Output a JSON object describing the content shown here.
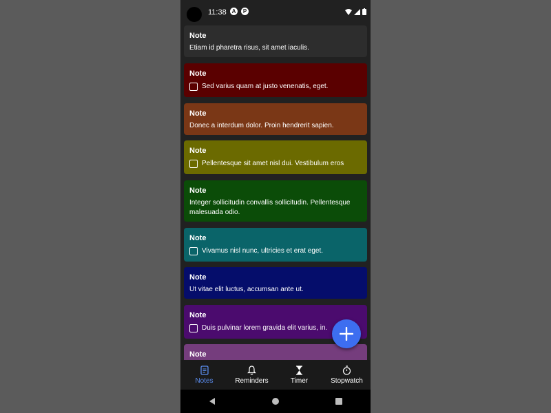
{
  "status_bar": {
    "time": "11:38"
  },
  "notes": [
    {
      "title": "Note",
      "body": "Etiam id pharetra risus, sit amet iaculis.",
      "checklist": false,
      "color": "#2d2d2d"
    },
    {
      "title": "Note",
      "body": "Sed varius quam at justo venenatis, eget.",
      "checklist": true,
      "color": "#5a0000"
    },
    {
      "title": "Note",
      "body": "Donec a interdum dolor. Proin hendrerit sapien.",
      "checklist": false,
      "color": "#7a3716"
    },
    {
      "title": "Note",
      "body": "Pellentesque sit amet nisl dui. Vestibulum eros",
      "checklist": true,
      "color": "#6b6a00"
    },
    {
      "title": "Note",
      "body": "Integer sollicitudin convallis sollicitudin. Pellentesque malesuada odio.",
      "checklist": false,
      "color": "#0b4c08"
    },
    {
      "title": "Note",
      "body": "Vivamus nisl nunc, ultricies et erat eget.",
      "checklist": true,
      "color": "#0a6469"
    },
    {
      "title": "Note",
      "body": "Ut vitae elit luctus, accumsan ante ut.",
      "checklist": false,
      "color": "#050d6b"
    },
    {
      "title": "Note",
      "body": "Duis pulvinar lorem gravida elit varius, in.",
      "checklist": true,
      "color": "#4b0b6e"
    },
    {
      "title": "Note",
      "body": "",
      "checklist": false,
      "color": "#753d7d"
    }
  ],
  "fab": {
    "icon": "plus-icon"
  },
  "bottom_nav": {
    "items": [
      {
        "label": "Notes",
        "icon": "notes-icon",
        "active": true
      },
      {
        "label": "Reminders",
        "icon": "bell-icon",
        "active": false
      },
      {
        "label": "Timer",
        "icon": "hourglass-icon",
        "active": false
      },
      {
        "label": "Stopwatch",
        "icon": "stopwatch-icon",
        "active": false
      }
    ]
  },
  "colors": {
    "accent": "#3d6ef0",
    "active_nav": "#5b8def",
    "background": "#212121"
  }
}
